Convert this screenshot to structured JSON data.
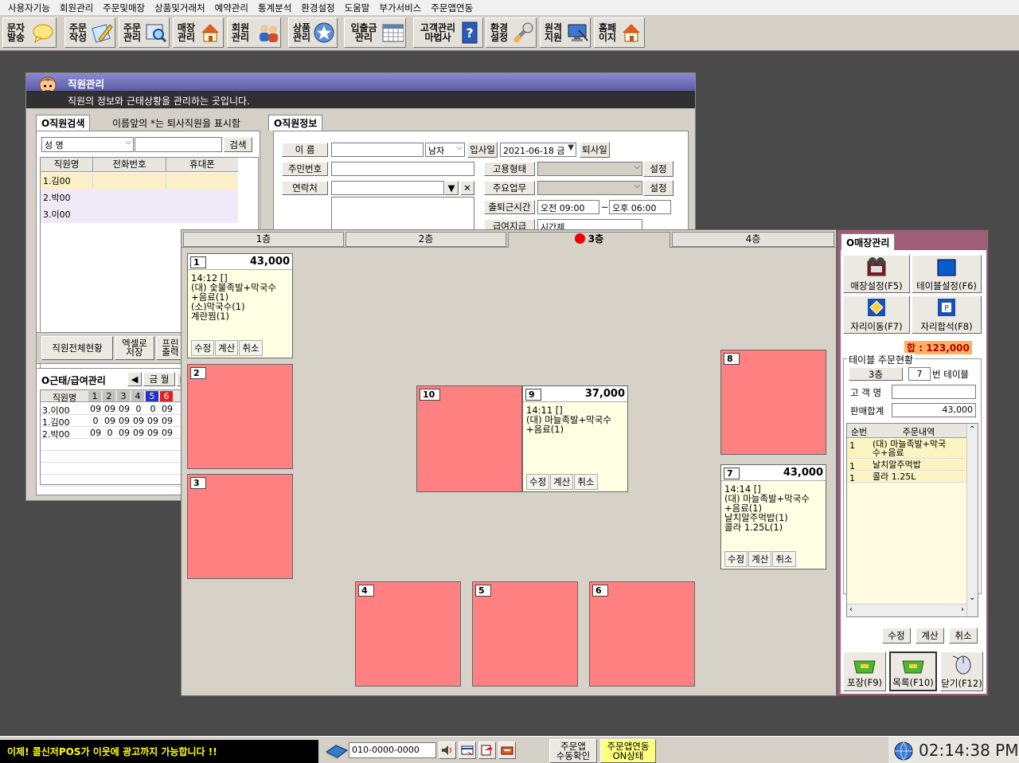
{
  "menu": [
    "사용자기능",
    "회원관리",
    "주문및매장",
    "상품및거래처",
    "예약관리",
    "통계분석",
    "환경설정",
    "도움말",
    "부가서비스",
    "주문앱연동"
  ],
  "toolbar": [
    {
      "label": "문자\n발송",
      "icon": "speech-bubble-icon"
    },
    {
      "label": "주문\n작성",
      "icon": "order-write-icon"
    },
    {
      "label": "주문\n관리",
      "icon": "order-search-icon"
    },
    {
      "label": "매장\n관리",
      "icon": "store-house-icon"
    },
    {
      "label": "회원\n관리",
      "icon": "members-icon"
    },
    {
      "label": "상품\n관리",
      "icon": "product-star-icon"
    },
    {
      "label": "입출금\n관리",
      "icon": "calendar-icon"
    },
    {
      "label": "고객관리\n마법사",
      "icon": "help-book-icon"
    },
    {
      "label": "환경\n설정",
      "icon": "wrench-icon"
    },
    {
      "label": "원격\n지원",
      "icon": "remote-monitor-icon"
    },
    {
      "label": "홈페\n이지",
      "icon": "home-icon"
    }
  ],
  "staff_window": {
    "title": "직원관리",
    "subtitle": "직원의 정보와 근태상황을 관리하는 곳입니다.",
    "search_tab": "O직원검색",
    "retired_note": "이름앞의 *는 퇴사직원을 표시함",
    "search_field": "성       명",
    "search_button": "검색",
    "columns": [
      "직원명",
      "전화번호",
      "휴대폰"
    ],
    "rows": [
      "1.김00",
      "2.박00",
      "3.이00"
    ],
    "bottom_buttons": [
      "직원전체현황",
      "엑셀로\n저장",
      "프린\n출력"
    ],
    "info_tab": "O직원정보",
    "info": {
      "name_label": "이    름",
      "gender": "남자",
      "hire_label": "입사일",
      "hire_date": "2021-06-18 금",
      "retire_label": "퇴사일",
      "rrn_label": "주민번호",
      "employ_label": "고용형태",
      "set_label": "설정",
      "contact_label": "연락처",
      "duty_label": "주요업무",
      "commute_label": "출퇴근시간",
      "in_time": "오전 09:00",
      "tilde": "~",
      "out_time": "오후 06:00",
      "pay_label": "급여지급",
      "pay_type": "시간제"
    },
    "attendance": {
      "tab": "O근태/급여관리",
      "month": "금 월",
      "name_col": "직원명",
      "days": [
        "1",
        "2",
        "3",
        "4",
        "5",
        "6"
      ],
      "rows": [
        {
          "name": "3.이00",
          "vals": [
            "09",
            "09",
            "09",
            "0",
            "0",
            "09"
          ]
        },
        {
          "name": "1.김00",
          "vals": [
            "0",
            "09",
            "09",
            "09",
            "09",
            "09"
          ]
        },
        {
          "name": "2.박00",
          "vals": [
            "09",
            "0",
            "09",
            "09",
            "09",
            "09"
          ]
        }
      ]
    }
  },
  "floor_window": {
    "floors": [
      "1층",
      "2층",
      "3층",
      "4층"
    ],
    "active_floor": "3층",
    "tables": [
      {
        "no": "1",
        "amount": "43,000",
        "order": "14:12 []\n(대) 숯불족발+막국수\n+음료(1)\n(소)막국수(1)\n계란찜(1)",
        "actions": [
          "수정",
          "계산",
          "취소"
        ]
      },
      {
        "no": "2"
      },
      {
        "no": "3"
      },
      {
        "no": "4"
      },
      {
        "no": "5"
      },
      {
        "no": "6"
      },
      {
        "no": "7",
        "amount": "43,000",
        "order": "14:14 []\n(대) 마늘족발+막국수\n+음료(1)\n날치알주먹밥(1)\n콜라 1.25L(1)",
        "actions": [
          "수정",
          "계산",
          "취소"
        ]
      },
      {
        "no": "8"
      },
      {
        "no": "9",
        "amount": "37,000",
        "order": "14:11 []\n(대) 마늘족발+막국수\n+음료(1)",
        "actions": [
          "수정",
          "계산",
          "취소"
        ]
      },
      {
        "no": "10"
      }
    ]
  },
  "store_panel": {
    "tab": "O매장관리",
    "buttons": [
      "매장설정(F5)",
      "테이블설정(F6)",
      "자리이동(F7)",
      "자리합석(F8)"
    ],
    "total": "합 : 123,000",
    "status_title": "테이블 주문현황",
    "floor": "3층",
    "table_no": "7",
    "table_suffix": "번 테이블",
    "customer_label": "고 객 명",
    "sum_label": "판매합계",
    "sum_value": "43,000",
    "columns": [
      "순번",
      "주문내역"
    ],
    "items": [
      {
        "qty": "1",
        "name": "(대) 마늘족발+막국\n수+음료"
      },
      {
        "qty": "1",
        "name": "날치알주먹밥"
      },
      {
        "qty": "1",
        "name": "콜라 1.25L"
      }
    ],
    "actions": [
      "수정",
      "계산",
      "취소"
    ],
    "bottom": [
      "포장(F9)",
      "목록(F10)",
      "닫기(F12)"
    ]
  },
  "statusbar": {
    "ad": "이제! 콜신저POS가 이웃에 광고까지 가능합니다 !!",
    "phone": "010-0000-0000",
    "app_check": "주문앱\n수동확인",
    "app_status": "주문앱연동\nON상태",
    "clock": "02:14:38 PM"
  },
  "colors": {
    "occupied": "#ffffe4",
    "empty": "#ff8080",
    "ad_text": "#ffff00",
    "panel_border": "#a0607a"
  }
}
